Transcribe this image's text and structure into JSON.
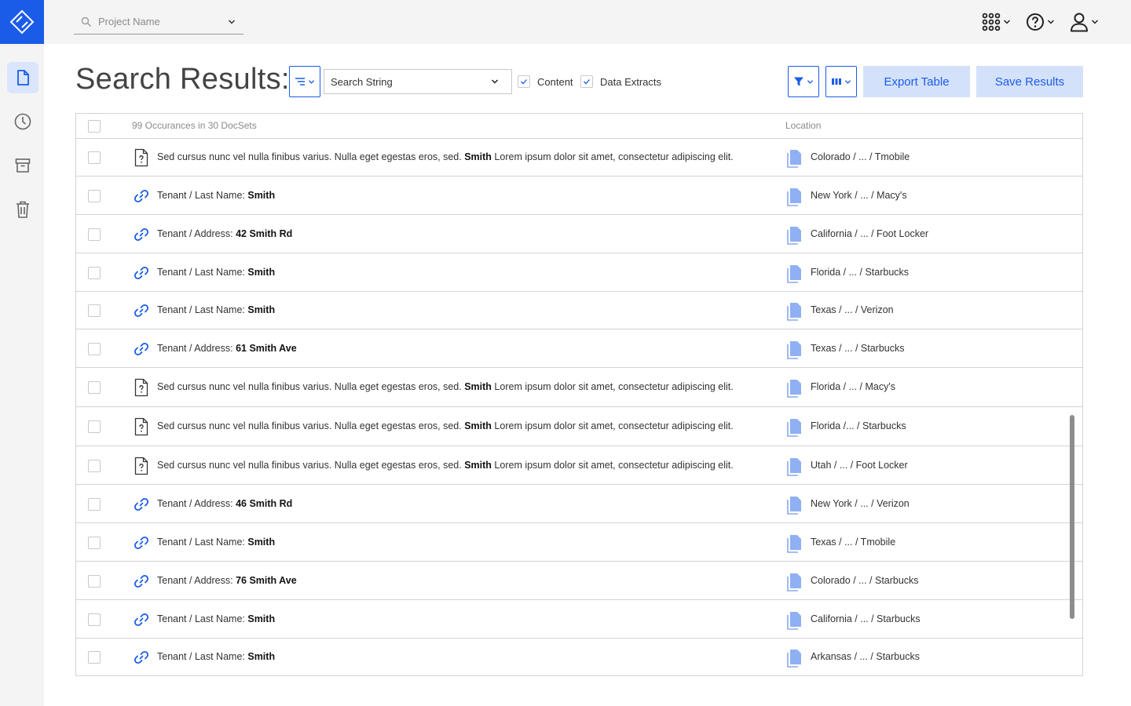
{
  "topbar": {
    "project_placeholder": "Project Name"
  },
  "sidebar": {
    "items": [
      {
        "name": "documents",
        "icon": "document-icon",
        "active": true
      },
      {
        "name": "history",
        "icon": "clock-icon",
        "active": false
      },
      {
        "name": "archive",
        "icon": "archive-icon",
        "active": false
      },
      {
        "name": "trash",
        "icon": "trash-icon",
        "active": false
      }
    ]
  },
  "header": {
    "title": "Search Results:",
    "search_select_value": "Search String",
    "content_label": "Content",
    "content_checked": true,
    "data_extracts_label": "Data Extracts",
    "data_extracts_checked": true,
    "export_label": "Export Table",
    "save_label": "Save Results"
  },
  "table": {
    "header_summary": "99 Occurances in 30 DocSets",
    "header_location": "Location",
    "rows": [
      {
        "type": "content",
        "prefix": "Sed cursus nunc vel nulla finibus varius. Nulla eget egestas eros, sed.",
        "match": "Smith",
        "suffix": "Lorem ipsum dolor sit amet, consectetur adipiscing elit.",
        "location": "Colorado / ... / Tmobile"
      },
      {
        "type": "extract",
        "prefix": "Tenant / Last Name:",
        "match": "Smith",
        "suffix": "",
        "location": "New York / ... / Macy's"
      },
      {
        "type": "extract",
        "prefix": "Tenant / Address:",
        "match": "42 Smith Rd",
        "suffix": "",
        "location": "California / ... / Foot Locker"
      },
      {
        "type": "extract",
        "prefix": "Tenant / Last Name:",
        "match": "Smith",
        "suffix": "",
        "location": "Florida / ... / Starbucks"
      },
      {
        "type": "extract",
        "prefix": "Tenant / Last Name:",
        "match": "Smith",
        "suffix": "",
        "location": "Texas / ... / Verizon"
      },
      {
        "type": "extract",
        "prefix": "Tenant / Address:",
        "match": "61 Smith Ave",
        "suffix": "",
        "location": "Texas / ... / Starbucks"
      },
      {
        "type": "content",
        "prefix": "Sed cursus nunc vel nulla finibus varius. Nulla eget egestas eros, sed.",
        "match": "Smith",
        "suffix": "Lorem ipsum dolor sit amet, consectetur adipiscing elit.",
        "location": "Florida / ... / Macy's"
      },
      {
        "type": "content",
        "prefix": "Sed cursus nunc vel nulla finibus varius. Nulla eget egestas eros, sed.",
        "match": "Smith",
        "suffix": "Lorem ipsum dolor sit amet, consectetur adipiscing elit.",
        "location": "Florida /... / Starbucks"
      },
      {
        "type": "content",
        "prefix": "Sed cursus nunc vel nulla finibus varius. Nulla eget egestas eros, sed.",
        "match": "Smith",
        "suffix": "Lorem ipsum dolor sit amet, consectetur adipiscing elit.",
        "location": "Utah / ... / Foot Locker"
      },
      {
        "type": "extract",
        "prefix": "Tenant / Address:",
        "match": "46 Smith Rd",
        "suffix": "",
        "location": "New York / ... / Verizon"
      },
      {
        "type": "extract",
        "prefix": "Tenant / Last Name:",
        "match": "Smith",
        "suffix": "",
        "location": "Texas / ... / Tmobile"
      },
      {
        "type": "extract",
        "prefix": "Tenant / Address:",
        "match": "76 Smith Ave",
        "suffix": "",
        "location": "Colorado / ... / Starbucks"
      },
      {
        "type": "extract",
        "prefix": "Tenant / Last Name:",
        "match": "Smith",
        "suffix": "",
        "location": "California / ... / Starbucks"
      },
      {
        "type": "extract",
        "prefix": "Tenant / Last Name:",
        "match": "Smith",
        "suffix": "",
        "location": "Arkansas / ... / Starbucks"
      }
    ]
  },
  "colors": {
    "brand": "#1a5ce8",
    "button_bg": "#d4e1fa",
    "sidebar_bg": "#f4f4f4"
  }
}
